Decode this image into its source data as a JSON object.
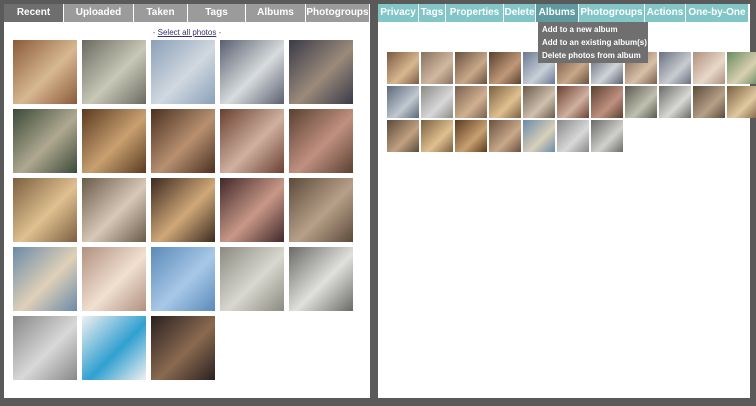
{
  "left_panel": {
    "tabs": [
      {
        "label": "Recent",
        "active": true
      },
      {
        "label": "Uploaded",
        "active": false
      },
      {
        "label": "Taken",
        "active": false
      },
      {
        "label": "Tags",
        "active": false
      },
      {
        "label": "Albums",
        "active": false
      },
      {
        "label": "Photogroups",
        "active": false
      }
    ],
    "select_all": {
      "prefix": "- ",
      "link": "Select all photos",
      "suffix": " -"
    },
    "photos": [
      {
        "name": "photo-people-at-table",
        "c1": "#8a5a3a",
        "c2": "#d8b890"
      },
      {
        "name": "photo-man-by-window",
        "c1": "#6a6a60",
        "c2": "#c8c8b8"
      },
      {
        "name": "photo-harbor-view",
        "c1": "#8aa0b8",
        "c2": "#d0d8e0"
      },
      {
        "name": "photo-city-panorama",
        "c1": "#5a6070",
        "c2": "#d8dcde"
      },
      {
        "name": "photo-chandelier",
        "c1": "#3a3a48",
        "c2": "#9a8a7a"
      },
      {
        "name": "photo-woman-sitting",
        "c1": "#3a4a38",
        "c2": "#b0a890"
      },
      {
        "name": "photo-group-dinner",
        "c1": "#5a3a20",
        "c2": "#c8a070"
      },
      {
        "name": "photo-dinner-table",
        "c1": "#4a3020",
        "c2": "#b89070"
      },
      {
        "name": "photo-party-sofa",
        "c1": "#6a4030",
        "c2": "#d0b0a0"
      },
      {
        "name": "photo-woman-standing",
        "c1": "#5a4030",
        "c2": "#c09080"
      },
      {
        "name": "photo-blonde-woman",
        "c1": "#7a6040",
        "c2": "#e0c090"
      },
      {
        "name": "photo-men-cooking",
        "c1": "#6a5a4a",
        "c2": "#d8c8b8"
      },
      {
        "name": "photo-woman-headband",
        "c1": "#3a2a20",
        "c2": "#d0a878"
      },
      {
        "name": "photo-woman-cap",
        "c1": "#402828",
        "c2": "#c89888"
      },
      {
        "name": "photo-face-painting",
        "c1": "#5a4a3a",
        "c2": "#b8a088"
      },
      {
        "name": "photo-baby-blue-hat",
        "c1": "#6a8aa8",
        "c2": "#e0d0b8"
      },
      {
        "name": "photo-baby-closeup",
        "c1": "#b09080",
        "c2": "#f0e0d0"
      },
      {
        "name": "photo-blue-document",
        "c1": "#5a8ab8",
        "c2": "#a8c8e8"
      },
      {
        "name": "photo-empty-room",
        "c1": "#8a8a80",
        "c2": "#d8d8d0"
      },
      {
        "name": "photo-attic-room",
        "c1": "#6a6a68",
        "c2": "#e0e0dc"
      },
      {
        "name": "photo-laptop-desk",
        "c1": "#888888",
        "c2": "#d8d8d8"
      },
      {
        "name": "photo-web-page",
        "c1": "#f0f0f0",
        "c2": "#30a0d0"
      },
      {
        "name": "photo-concert",
        "c1": "#2a2020",
        "c2": "#8a6a50"
      }
    ]
  },
  "right_panel": {
    "tabs": [
      {
        "label": "Privacy",
        "active": false
      },
      {
        "label": "Tags",
        "active": false
      },
      {
        "label": "Properties",
        "active": false
      },
      {
        "label": "Delete",
        "active": false
      },
      {
        "label": "Albums",
        "active": true
      },
      {
        "label": "Photogroups",
        "active": false
      },
      {
        "label": "Actions",
        "active": false
      },
      {
        "label": "One-by-One",
        "active": false
      }
    ],
    "albums_menu": [
      "Add to a new album",
      "Add to an existing album(s)",
      "Delete photos from album"
    ],
    "selected_photos": [
      {
        "c1": "#7a5a40",
        "c2": "#d8b890"
      },
      {
        "c1": "#8a7060",
        "c2": "#d0b8a0"
      },
      {
        "c1": "#6a5040",
        "c2": "#c8a888"
      },
      {
        "c1": "#5a4030",
        "c2": "#c09878"
      },
      {
        "c1": "#6a7890",
        "c2": "#c8d0d8"
      },
      {
        "c1": "#6a5040",
        "c2": "#c8a888"
      },
      {
        "c1": "#5a6070",
        "c2": "#d0d4d8"
      },
      {
        "c1": "#7a6050",
        "c2": "#d8c0a8"
      },
      {
        "c1": "#6a7080",
        "c2": "#c8ccd0"
      },
      {
        "c1": "#b09080",
        "c2": "#e8d8c8"
      },
      {
        "c1": "#6a8a60",
        "c2": "#d8d0b0"
      },
      {
        "c1": "#5a6878",
        "c2": "#c0c8d0"
      },
      {
        "c1": "#8a8a88",
        "c2": "#d8d8d8"
      },
      {
        "c1": "#7a6050",
        "c2": "#d0b090"
      },
      {
        "c1": "#7a6040",
        "c2": "#e0c090"
      },
      {
        "c1": "#6a5a4a",
        "c2": "#d0c0b0"
      },
      {
        "c1": "#6a4030",
        "c2": "#d0b0a0"
      },
      {
        "c1": "#5a4030",
        "c2": "#c09080"
      },
      {
        "c1": "#5a5a50",
        "c2": "#c0c0b0"
      },
      {
        "c1": "#6a6a68",
        "c2": "#d8d8d4"
      },
      {
        "c1": "#5a4a3a",
        "c2": "#b8a088"
      },
      {
        "c1": "#7a6040",
        "c2": "#e0c8a0"
      },
      {
        "c1": "#5a4a3a",
        "c2": "#c0a080"
      },
      {
        "c1": "#7a6040",
        "c2": "#e0c090"
      },
      {
        "c1": "#5a3a20",
        "c2": "#c8a070"
      },
      {
        "c1": "#6a5040",
        "c2": "#c8a888"
      },
      {
        "c1": "#6a8aa8",
        "c2": "#d8d0b8"
      },
      {
        "c1": "#888888",
        "c2": "#d8d8d8"
      },
      {
        "c1": "#6a6a68",
        "c2": "#d0d0cc"
      }
    ]
  }
}
